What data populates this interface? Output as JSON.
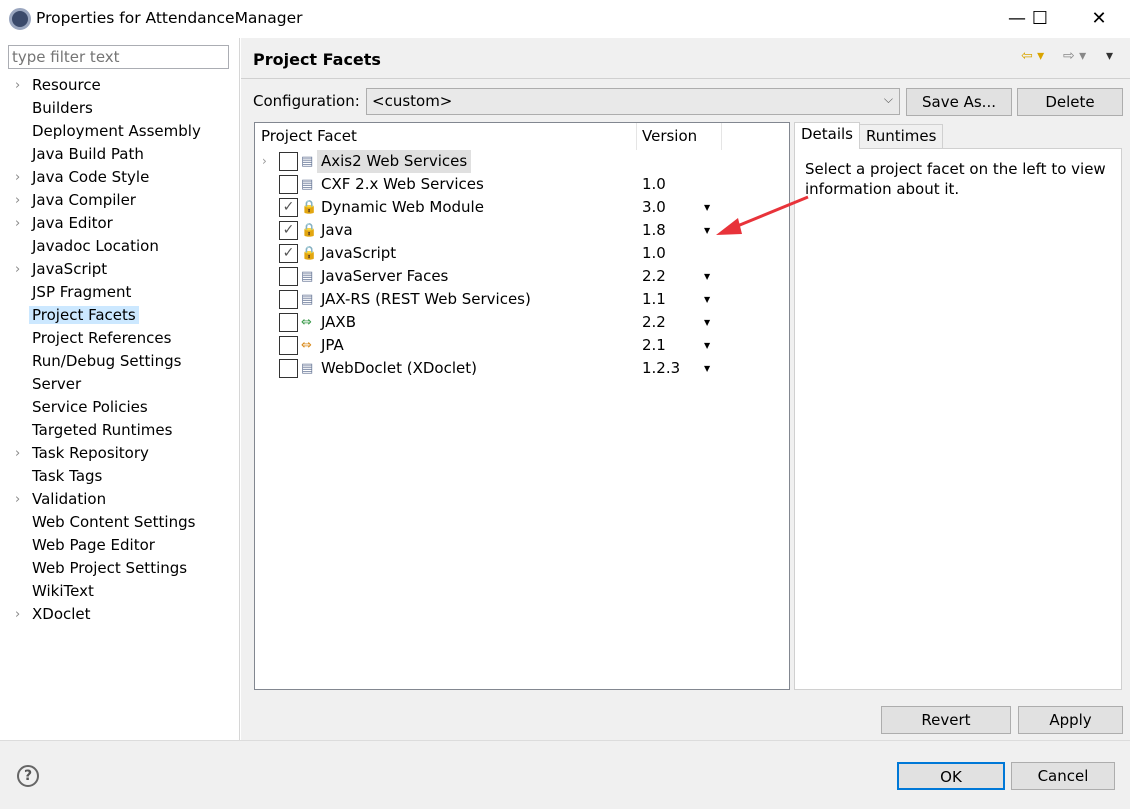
{
  "window": {
    "title": "Properties for AttendanceManager",
    "minimize": "—",
    "maximize": "☐",
    "close": "✕"
  },
  "filter": {
    "placeholder": "type filter text"
  },
  "tree": [
    {
      "label": "Resource",
      "expandable": true
    },
    {
      "label": "Builders"
    },
    {
      "label": "Deployment Assembly"
    },
    {
      "label": "Java Build Path"
    },
    {
      "label": "Java Code Style",
      "expandable": true
    },
    {
      "label": "Java Compiler",
      "expandable": true
    },
    {
      "label": "Java Editor",
      "expandable": true
    },
    {
      "label": "Javadoc Location"
    },
    {
      "label": "JavaScript",
      "expandable": true
    },
    {
      "label": "JSP Fragment"
    },
    {
      "label": "Project Facets",
      "selected": true
    },
    {
      "label": "Project References"
    },
    {
      "label": "Run/Debug Settings"
    },
    {
      "label": "Server"
    },
    {
      "label": "Service Policies"
    },
    {
      "label": "Targeted Runtimes"
    },
    {
      "label": "Task Repository",
      "expandable": true
    },
    {
      "label": "Task Tags"
    },
    {
      "label": "Validation",
      "expandable": true
    },
    {
      "label": "Web Content Settings"
    },
    {
      "label": "Web Page Editor"
    },
    {
      "label": "Web Project Settings"
    },
    {
      "label": "WikiText"
    },
    {
      "label": "XDoclet",
      "expandable": true
    }
  ],
  "page": {
    "title": "Project Facets",
    "config_label": "Configuration:",
    "config_value": "<custom>",
    "save_as": "Save As...",
    "delete": "Delete"
  },
  "table": {
    "headers": [
      "Project Facet",
      "Version"
    ],
    "rows": [
      {
        "name": "Axis2 Web Services",
        "version": "",
        "checked": false,
        "icon": "doc",
        "expandable": true,
        "dropdown": false,
        "highlight": true
      },
      {
        "name": "CXF 2.x Web Services",
        "version": "1.0",
        "checked": false,
        "icon": "doc",
        "dropdown": false
      },
      {
        "name": "Dynamic Web Module",
        "version": "3.0",
        "checked": true,
        "icon": "locked-web",
        "dropdown": true
      },
      {
        "name": "Java",
        "version": "1.8",
        "checked": true,
        "icon": "locked-java",
        "dropdown": true
      },
      {
        "name": "JavaScript",
        "version": "1.0",
        "checked": true,
        "icon": "locked-doc",
        "dropdown": false
      },
      {
        "name": "JavaServer Faces",
        "version": "2.2",
        "checked": false,
        "icon": "doc",
        "dropdown": true
      },
      {
        "name": "JAX-RS (REST Web Services)",
        "version": "1.1",
        "checked": false,
        "icon": "doc",
        "dropdown": true
      },
      {
        "name": "JAXB",
        "version": "2.2",
        "checked": false,
        "icon": "arrows-green",
        "dropdown": true
      },
      {
        "name": "JPA",
        "version": "2.1",
        "checked": false,
        "icon": "arrows-orange",
        "dropdown": true
      },
      {
        "name": "WebDoclet (XDoclet)",
        "version": "1.2.3",
        "checked": false,
        "icon": "doc",
        "dropdown": true
      }
    ]
  },
  "details": {
    "tabs": [
      "Details",
      "Runtimes"
    ],
    "text": "Select a project facet on the left to view information about it."
  },
  "buttons": {
    "revert": "Revert",
    "apply": "Apply",
    "ok": "OK",
    "cancel": "Cancel",
    "help": "?"
  },
  "colors": {
    "selection": "#cce8ff",
    "annotation_arrow": "#e8333a",
    "default_button_border": "#0078d7"
  }
}
